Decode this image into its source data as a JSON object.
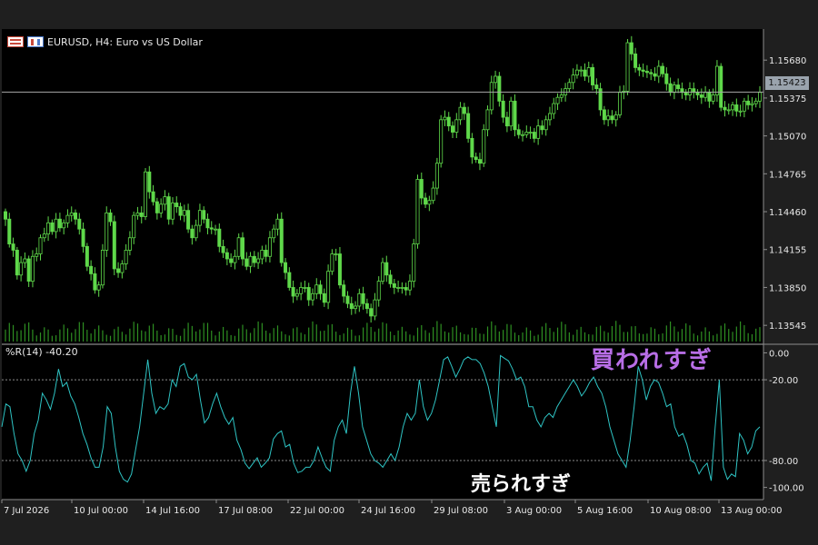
{
  "header": {
    "symbol_label": "EURUSD, H4:  Euro vs US Dollar"
  },
  "indicator": {
    "title": "%R(14) -40.20"
  },
  "price_tag": "1.15423",
  "annotations": {
    "overbought": "買われすぎ",
    "oversold": "売られすぎ"
  },
  "colors": {
    "background": "#000000",
    "frame": "#1f1f1f",
    "candle": "#5fd84a",
    "volume": "#2e8f22",
    "indicator_line": "#2ec4c4",
    "grid_axis": "#8c8c8c",
    "price_line": "#a8a8a8",
    "overbought_text": "#b86ee6",
    "oversold_text": "#ffffff"
  },
  "chart_data": [
    {
      "type": "candlestick",
      "title": "EURUSD, H4:  Euro vs US Dollar",
      "y_ticks": [
        "1.15680",
        "1.15375",
        "1.15070",
        "1.14765",
        "1.14460",
        "1.14155",
        "1.13850",
        "1.13545"
      ],
      "ylim": [
        1.134,
        1.1593
      ],
      "last_price": 1.15423,
      "close": [
        1.144,
        1.142,
        1.1415,
        1.1395,
        1.1405,
        1.1408,
        1.139,
        1.141,
        1.1412,
        1.1425,
        1.1428,
        1.1437,
        1.143,
        1.144,
        1.1433,
        1.1437,
        1.1443,
        1.1445,
        1.144,
        1.1432,
        1.1418,
        1.1402,
        1.1396,
        1.1383,
        1.1387,
        1.1415,
        1.1445,
        1.1438,
        1.14,
        1.1397,
        1.1404,
        1.1415,
        1.1425,
        1.1443,
        1.1445,
        1.1442,
        1.1478,
        1.1462,
        1.1454,
        1.1445,
        1.1452,
        1.1458,
        1.144,
        1.1453,
        1.145,
        1.1443,
        1.1447,
        1.1432,
        1.1425,
        1.1435,
        1.1447,
        1.144,
        1.1433,
        1.1432,
        1.1432,
        1.1418,
        1.1413,
        1.1408,
        1.1405,
        1.141,
        1.1425,
        1.1408,
        1.1402,
        1.141,
        1.1405,
        1.1408,
        1.1415,
        1.141,
        1.1425,
        1.1432,
        1.144,
        1.1405,
        1.1397,
        1.1385,
        1.1378,
        1.138,
        1.1385,
        1.1385,
        1.1375,
        1.138,
        1.1387,
        1.138,
        1.1373,
        1.1398,
        1.1412,
        1.1412,
        1.1387,
        1.1378,
        1.1372,
        1.1368,
        1.137,
        1.138,
        1.1372,
        1.1368,
        1.1362,
        1.1375,
        1.139,
        1.1405,
        1.1395,
        1.1388,
        1.1385,
        1.1385,
        1.1385,
        1.1383,
        1.139,
        1.142,
        1.1472,
        1.1457,
        1.1452,
        1.1455,
        1.1465,
        1.1485,
        1.152,
        1.1522,
        1.1515,
        1.151,
        1.152,
        1.153,
        1.1525,
        1.1505,
        1.149,
        1.1488,
        1.1485,
        1.1512,
        1.1528,
        1.155,
        1.1555,
        1.1535,
        1.1522,
        1.1515,
        1.1535,
        1.1512,
        1.1508,
        1.1508,
        1.151,
        1.151,
        1.1505,
        1.1515,
        1.1512,
        1.152,
        1.1525,
        1.1533,
        1.1538,
        1.154,
        1.1545,
        1.155,
        1.1556,
        1.156,
        1.156,
        1.1555,
        1.1562,
        1.1548,
        1.1545,
        1.1528,
        1.152,
        1.1523,
        1.152,
        1.1524,
        1.1542,
        1.1543,
        1.1582,
        1.1573,
        1.1562,
        1.156,
        1.1559,
        1.1558,
        1.1557,
        1.1555,
        1.1563,
        1.1557,
        1.1549,
        1.1542,
        1.1548,
        1.1545,
        1.1542,
        1.154,
        1.1545,
        1.1542,
        1.154,
        1.1538,
        1.1542,
        1.1535,
        1.154,
        1.1563,
        1.153,
        1.1528,
        1.1528,
        1.1532,
        1.1527,
        1.1527,
        1.1535,
        1.1532,
        1.1533,
        1.1535,
        1.1542
      ]
    },
    {
      "type": "line",
      "title": "%R(14) -40.20",
      "series": [
        {
          "name": "%R(14)",
          "values": [
            -55,
            -38,
            -40,
            -60,
            -75,
            -80,
            -88,
            -80,
            -60,
            -50,
            -30,
            -35,
            -42,
            -30,
            -12,
            -25,
            -22,
            -32,
            -38,
            -48,
            -60,
            -68,
            -78,
            -85,
            -85,
            -70,
            -40,
            -45,
            -70,
            -88,
            -94,
            -96,
            -90,
            -72,
            -55,
            -30,
            -5,
            -30,
            -45,
            -40,
            -42,
            -38,
            -20,
            -25,
            -10,
            -8,
            -18,
            -20,
            -16,
            -35,
            -52,
            -48,
            -38,
            -30,
            -40,
            -48,
            -53,
            -48,
            -65,
            -72,
            -82,
            -86,
            -82,
            -78,
            -85,
            -82,
            -78,
            -64,
            -60,
            -58,
            -70,
            -68,
            -82,
            -89,
            -88,
            -85,
            -85,
            -80,
            -70,
            -78,
            -85,
            -88,
            -65,
            -55,
            -50,
            -60,
            -30,
            -10,
            -30,
            -55,
            -65,
            -75,
            -80,
            -82,
            -85,
            -80,
            -75,
            -80,
            -70,
            -55,
            -45,
            -50,
            -45,
            -20,
            -40,
            -50,
            -45,
            -35,
            -20,
            -5,
            -3,
            -10,
            -18,
            -12,
            -5,
            -3,
            -5,
            -5,
            -8,
            -15,
            -25,
            -40,
            -55,
            -2,
            -4,
            -6,
            -12,
            -20,
            -18,
            -25,
            -40,
            -40,
            -50,
            -55,
            -48,
            -45,
            -48,
            -40,
            -35,
            -30,
            -25,
            -20,
            -25,
            -32,
            -28,
            -22,
            -18,
            -25,
            -30,
            -40,
            -55,
            -65,
            -75,
            -80,
            -85,
            -65,
            -40,
            -10,
            -20,
            -35,
            -25,
            -20,
            -22,
            -30,
            -40,
            -38,
            -55,
            -62,
            -60,
            -68,
            -80,
            -82,
            -90,
            -85,
            -82,
            -95,
            -55,
            -20,
            -85,
            -94,
            -90,
            -92,
            -60,
            -65,
            -75,
            -70,
            -58,
            -55
          ]
        }
      ],
      "y_ticks": [
        "0.00",
        "-20.00",
        "-80.00",
        "-100.00"
      ],
      "ylim": [
        -105,
        3
      ],
      "levels": [
        -20,
        -80
      ],
      "x_ticks": [
        "7 Jul 2026",
        "10 Jul 00:00",
        "14 Jul 16:00",
        "17 Jul 08:00",
        "22 Jul 00:00",
        "24 Jul 16:00",
        "29 Jul 08:00",
        "3 Aug 00:00",
        "5 Aug 16:00",
        "10 Aug 08:00",
        "13 Aug 00:00"
      ]
    }
  ]
}
